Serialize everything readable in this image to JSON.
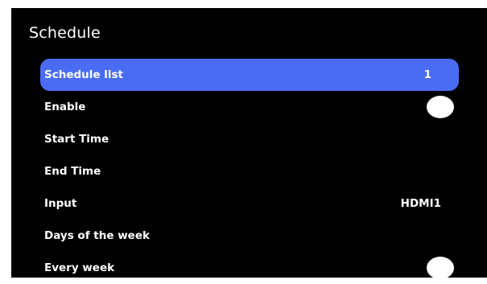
{
  "screen": {
    "title": "Schedule"
  },
  "menu": {
    "items": [
      {
        "label": "Schedule list",
        "value": "1"
      },
      {
        "label": "Enable",
        "control": "toggle"
      },
      {
        "label": "Start Time"
      },
      {
        "label": "End Time"
      },
      {
        "label": "Input",
        "value": "HDMI1"
      },
      {
        "label": "Days of the week"
      },
      {
        "label": "Every week",
        "control": "toggle"
      }
    ]
  },
  "colors": {
    "background": "#000000",
    "highlight": "#4a6cf5",
    "text": "#ffffff"
  }
}
